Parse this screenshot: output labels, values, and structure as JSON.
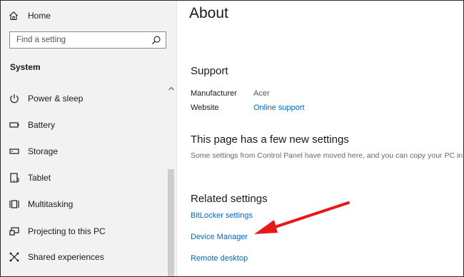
{
  "sidebar": {
    "home_label": "Home",
    "search_placeholder": "Find a setting",
    "section_label": "System",
    "items": [
      {
        "label": "Power & sleep",
        "icon": "power-icon"
      },
      {
        "label": "Battery",
        "icon": "battery-icon"
      },
      {
        "label": "Storage",
        "icon": "storage-icon"
      },
      {
        "label": "Tablet",
        "icon": "tablet-icon"
      },
      {
        "label": "Multitasking",
        "icon": "multitasking-icon"
      },
      {
        "label": "Projecting to this PC",
        "icon": "projecting-icon"
      },
      {
        "label": "Shared experiences",
        "icon": "shared-experiences-icon"
      }
    ]
  },
  "main": {
    "title": "About",
    "support": {
      "heading": "Support",
      "manufacturer_label": "Manufacturer",
      "manufacturer_value": "Acer",
      "website_label": "Website",
      "website_link": "Online support"
    },
    "new_settings": {
      "heading": "This page has a few new settings",
      "note": "Some settings from Control Panel have moved here, and you can copy your PC in"
    },
    "related": {
      "heading": "Related settings",
      "links": [
        "BitLocker settings",
        "Device Manager",
        "Remote desktop"
      ]
    }
  },
  "colors": {
    "link": "#0067c0",
    "sidebar_bg": "#f2f2f2",
    "annotation_arrow": "#e81818"
  }
}
